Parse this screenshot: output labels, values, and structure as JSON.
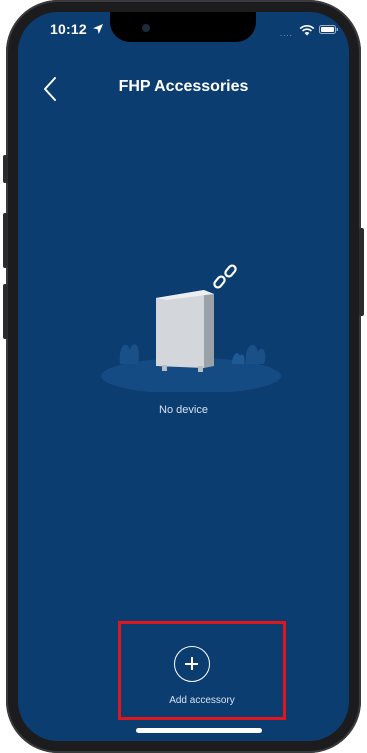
{
  "status_bar": {
    "time": "10:12",
    "signal": "....",
    "icons": [
      "location-arrow-icon",
      "wifi-icon",
      "battery-icon"
    ]
  },
  "nav": {
    "title": "FHP Accessories",
    "back_icon": "chevron-left-icon"
  },
  "empty_state": {
    "illustration": "device-unlinked-illustration",
    "message": "No device"
  },
  "add_accessory": {
    "icon": "plus-circle-icon",
    "label": "Add accessory"
  },
  "colors": {
    "background": "#0c3d70",
    "highlight": "#e0161e",
    "text": "#ffffff"
  }
}
